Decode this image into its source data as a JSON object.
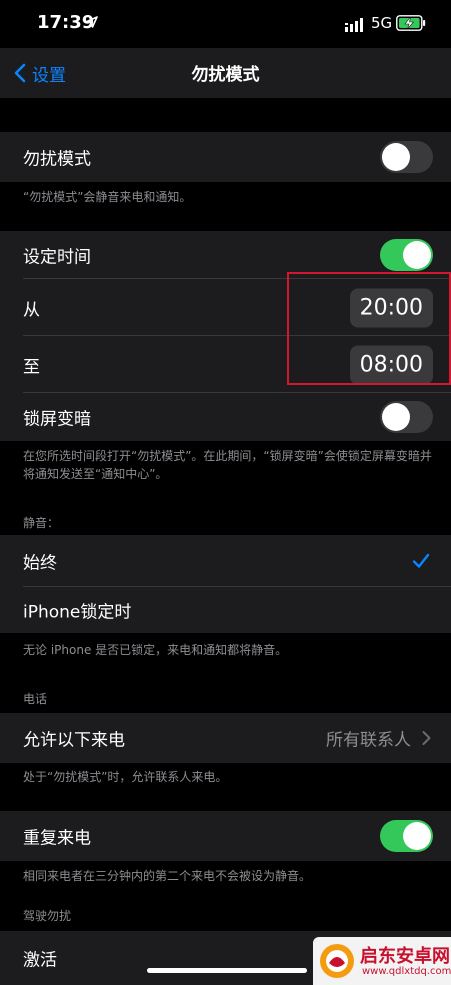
{
  "status_bar": {
    "time": "17:39",
    "network": "5G"
  },
  "nav": {
    "back_label": "设置",
    "title": "勿扰模式"
  },
  "dnd": {
    "label": "勿扰模式",
    "enabled": false,
    "note": "“勿扰模式”会静音来电和通知。"
  },
  "schedule": {
    "label": "设定时间",
    "enabled": true,
    "from_label": "从",
    "from_time": "20:00",
    "to_label": "至",
    "to_time": "08:00",
    "dim_label": "锁屏变暗",
    "dim_enabled": false,
    "note": "在您所选时间段打开“勿扰模式”。在此期间，“锁屏变暗”会使锁定屏幕变暗并将通知发送至“通知中心”。"
  },
  "silence": {
    "header": "静音：",
    "always_label": "始终",
    "locked_label": "iPhone锁定时",
    "selected": "始终",
    "note": "无论 iPhone 是否已锁定，来电和通知都将静音。"
  },
  "phone": {
    "header": "电话",
    "allow_calls_label": "允许以下来电",
    "allow_calls_value": "所有联系人",
    "allow_calls_note": "处于“勿扰模式”时，允许联系人来电。",
    "repeated_label": "重复来电",
    "repeated_enabled": true,
    "repeated_note": "相同来电者在三分钟内的第二个来电不会被设为静音。"
  },
  "driving": {
    "header": "驾驶勿扰",
    "activate_label": "激活"
  },
  "watermark": {
    "title": "启东安卓网",
    "url": "www.qdlxtdq.com"
  },
  "colors": {
    "accent": "#0a84ff",
    "toggle_on": "#34c759",
    "highlight": "#d2182f",
    "background": "#000000",
    "cell": "#1c1c1e"
  },
  "icons": [
    "location-arrow-icon",
    "signal-icon",
    "battery-charging-icon",
    "chevron-left-icon",
    "checkmark-icon",
    "chevron-right-icon",
    "watermark-logo-icon"
  ]
}
